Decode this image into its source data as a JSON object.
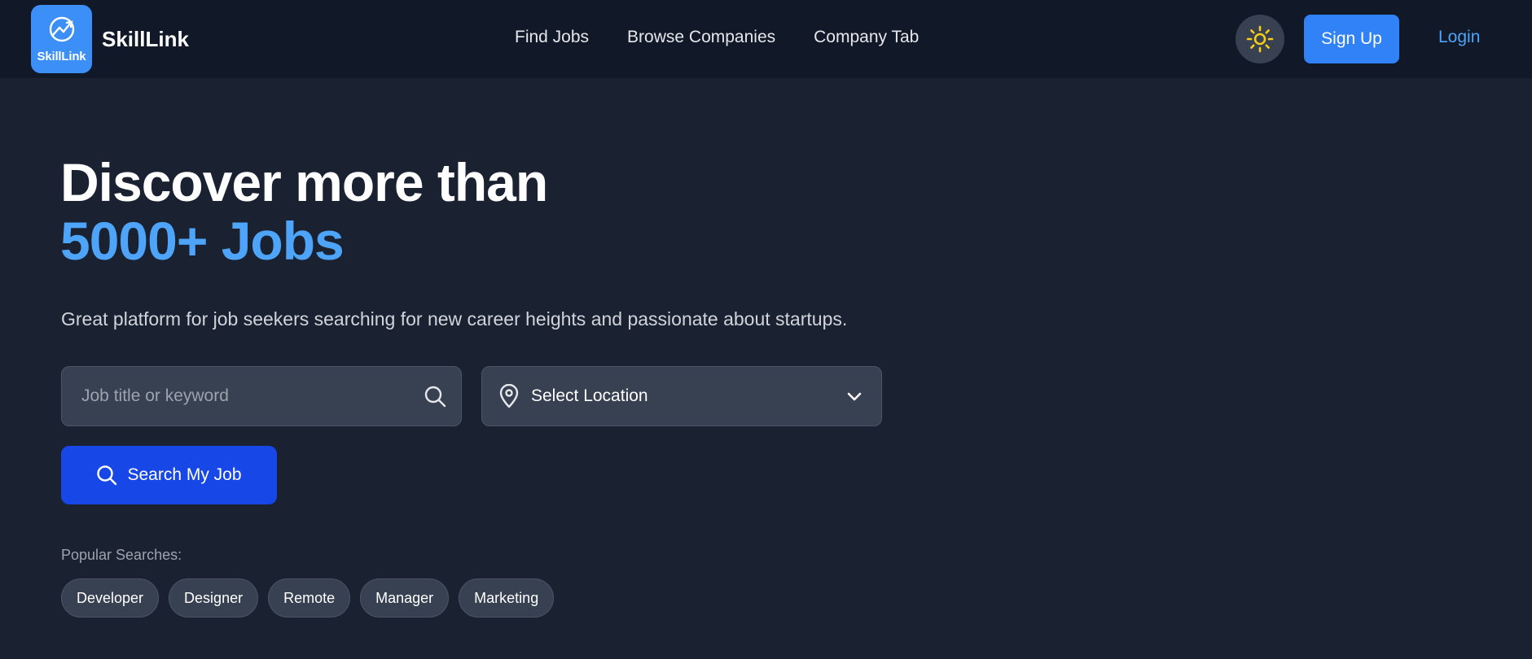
{
  "brand": {
    "logo_text": "SkillLink",
    "name": "SkillLink"
  },
  "nav": {
    "links": [
      "Find Jobs",
      "Browse Companies",
      "Company Tab"
    ],
    "theme_icon": "sun-icon",
    "signup_label": "Sign Up",
    "login_label": "Login"
  },
  "hero": {
    "title": "Discover more than",
    "highlight": "5000+ Jobs",
    "subtitle": "Great platform for job seekers searching for new career heights and passionate about startups."
  },
  "search": {
    "keyword_placeholder": "Job title or keyword",
    "location_label": "Select Location",
    "button_label": "Search My Job"
  },
  "popular": {
    "label": "Popular Searches:",
    "tags": [
      "Developer",
      "Designer",
      "Remote",
      "Manager",
      "Marketing"
    ]
  },
  "colors": {
    "background": "#1a2231",
    "navbar": "#111827",
    "accent": "#4ea4f9",
    "primary_button": "#3182f6",
    "search_button": "#1747e7",
    "sun": "#facc15"
  }
}
